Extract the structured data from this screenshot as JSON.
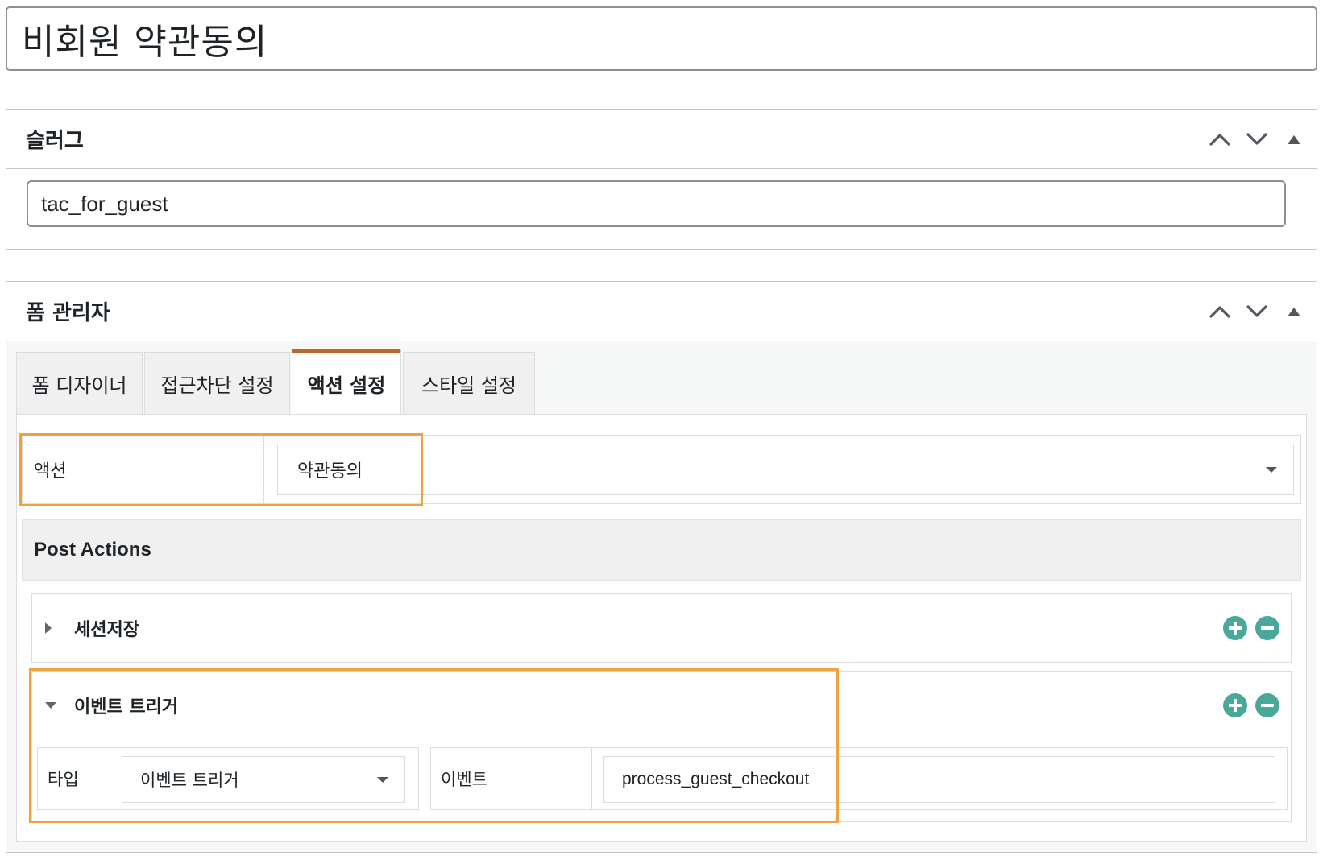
{
  "post_title": "비회원 약관동의",
  "slug_box": {
    "title": "슬러그",
    "value": "tac_for_guest"
  },
  "form_manager": {
    "title": "폼 관리자",
    "tabs": [
      {
        "label": "폼 디자이너",
        "active": false
      },
      {
        "label": "접근차단 설정",
        "active": false
      },
      {
        "label": "액션 설정",
        "active": true
      },
      {
        "label": "스타일 설정",
        "active": false
      }
    ],
    "action": {
      "label": "액션",
      "selected": "약관동의"
    },
    "post_actions": {
      "header": "Post Actions",
      "items": [
        {
          "title": "세션저장",
          "expanded": false
        },
        {
          "title": "이벤트 트리거",
          "expanded": true,
          "type_label": "타입",
          "type_value": "이벤트 트리거",
          "event_label": "이벤트",
          "event_value": "process_guest_checkout"
        }
      ]
    }
  },
  "colors": {
    "active_tab_accent": "#c0642d",
    "highlight": "#f0a03c",
    "round_button": "#4aa89a"
  },
  "icons": {
    "move_up": "chevron-up-icon",
    "move_down": "chevron-down-icon",
    "toggle": "triangle-up-icon",
    "add": "plus-circle-icon",
    "remove": "minus-circle-icon"
  }
}
